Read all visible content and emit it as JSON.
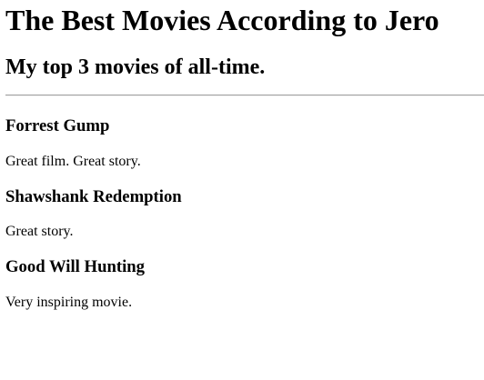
{
  "page": {
    "title": "The Best Movies According to Jero",
    "subtitle": "My top 3 movies of all-time."
  },
  "movies": [
    {
      "title": "Forrest Gump",
      "description": "Great film. Great story."
    },
    {
      "title": "Shawshank Redemption",
      "description": "Great story."
    },
    {
      "title": "Good Will Hunting",
      "description": "Very inspiring movie."
    }
  ]
}
